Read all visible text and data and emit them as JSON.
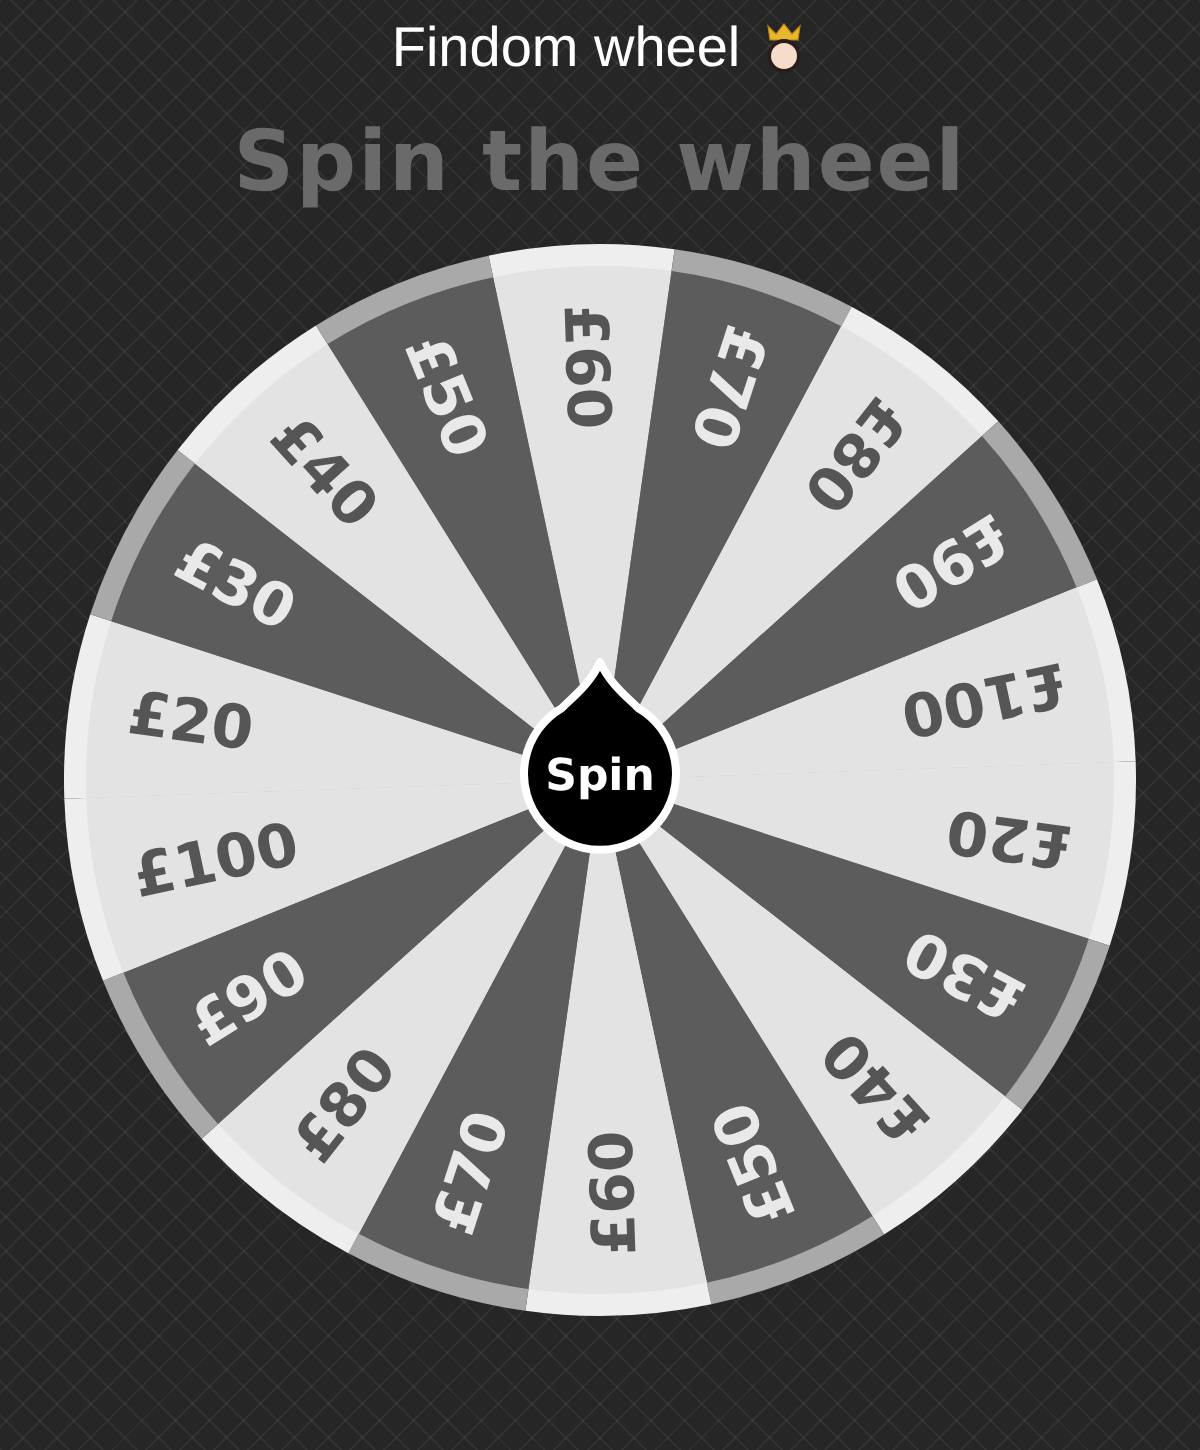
{
  "title": "Findom wheel",
  "heading": "Spin the wheel",
  "wheel": {
    "segments": [
      {
        "label": "£60",
        "kind": "light"
      },
      {
        "label": "£70",
        "kind": "dark"
      },
      {
        "label": "£80",
        "kind": "light"
      },
      {
        "label": "£90",
        "kind": "dark"
      },
      {
        "label": "£100",
        "kind": "light"
      },
      {
        "label": "£20",
        "kind": "light"
      },
      {
        "label": "£30",
        "kind": "dark"
      },
      {
        "label": "£40",
        "kind": "light"
      },
      {
        "label": "£50",
        "kind": "dark"
      },
      {
        "label": "£60",
        "kind": "light"
      },
      {
        "label": "£70",
        "kind": "dark"
      },
      {
        "label": "£80",
        "kind": "light"
      },
      {
        "label": "£90",
        "kind": "dark"
      },
      {
        "label": "£100",
        "kind": "light"
      },
      {
        "label": "£20",
        "kind": "light"
      },
      {
        "label": "£30",
        "kind": "dark"
      },
      {
        "label": "£40",
        "kind": "light"
      },
      {
        "label": "£50",
        "kind": "dark"
      }
    ]
  },
  "spin_button": "Spin"
}
